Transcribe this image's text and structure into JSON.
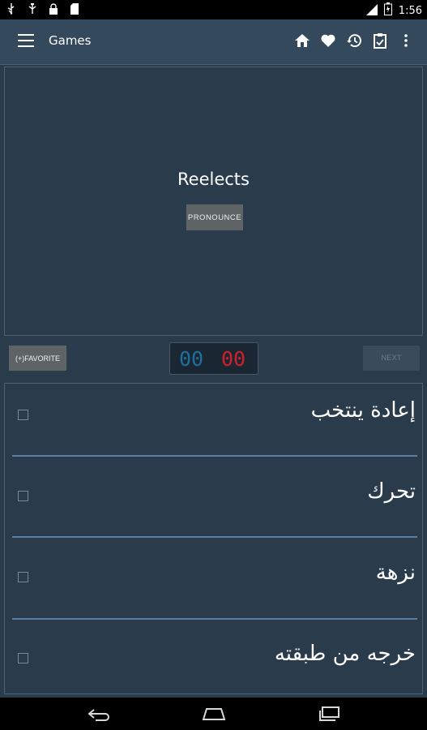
{
  "status_bar": {
    "time": "1:56",
    "left_icons": [
      "usb-icon",
      "usb-debug-icon",
      "lock-icon",
      "sd-card-icon"
    ],
    "right_icons": [
      "wifi-icon",
      "battery-icon"
    ]
  },
  "app_bar": {
    "title": "Games",
    "actions": [
      "home-icon",
      "heart-icon",
      "history-icon",
      "clipboard-icon",
      "more-vert-icon"
    ]
  },
  "card": {
    "word": "Reelects",
    "pronounce_label": "PRONOUNCE"
  },
  "controls": {
    "favorite_label": "(+)FAVORITE",
    "score_correct": "00",
    "score_wrong": "00",
    "next_label": "NEXT"
  },
  "options": [
    {
      "text": "إعادة ينتخب",
      "checked": false
    },
    {
      "text": "تحرك",
      "checked": false
    },
    {
      "text": "نزهة",
      "checked": false
    },
    {
      "text": "خرجه من طبقته",
      "checked": false
    }
  ],
  "colors": {
    "background": "#2a3b4c",
    "app_bar": "#34495c",
    "divider": "#5b7ea6",
    "score_correct": "#1e6fa0",
    "score_wrong": "#d0202c"
  },
  "nav_bar": [
    "back-icon",
    "home-nav-icon",
    "recents-icon"
  ]
}
